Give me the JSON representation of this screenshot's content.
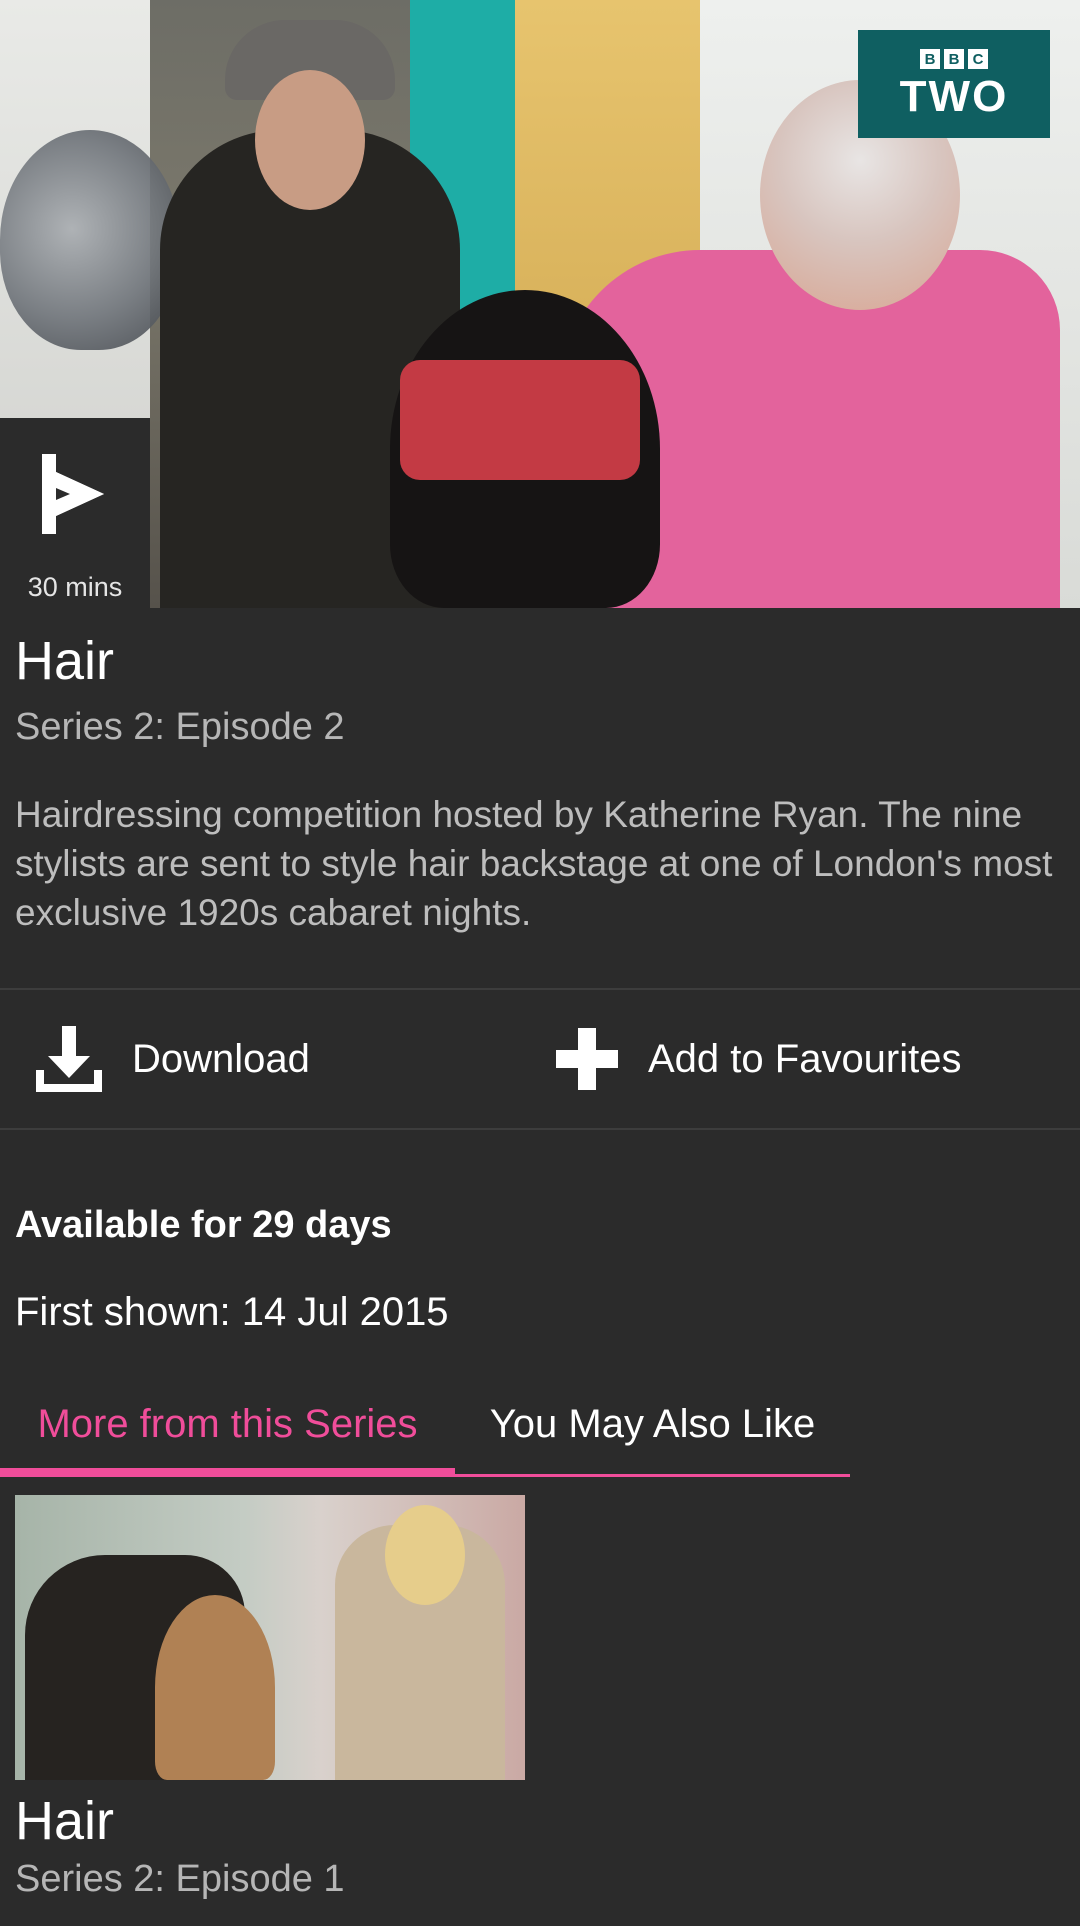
{
  "hero": {
    "channel_badge": {
      "brand_blocks": [
        "B",
        "B",
        "C"
      ],
      "channel": "TWO"
    },
    "duration": "30 mins"
  },
  "programme": {
    "title": "Hair",
    "subtitle": "Series 2: Episode 2",
    "description": "Hairdressing competition hosted by Katherine Ryan. The nine stylists are sent to style hair backstage at one of London's most exclusive 1920s cabaret nights."
  },
  "actions": {
    "download_label": "Download",
    "favourites_label": "Add to Favourites"
  },
  "availability": "Available for 29 days",
  "first_shown": "First shown: 14 Jul 2015",
  "tabs": [
    {
      "label": "More from this Series",
      "active": true
    },
    {
      "label": "You May Also Like",
      "active": false
    }
  ],
  "episodes": [
    {
      "title": "Hair",
      "subtitle": "Series 2: Episode 1"
    }
  ],
  "colors": {
    "background": "#2b2b2b",
    "accent": "#f04d9a",
    "channel_badge": "#0f5f61"
  },
  "icons": [
    "play-icon",
    "download-icon",
    "plus-icon"
  ]
}
